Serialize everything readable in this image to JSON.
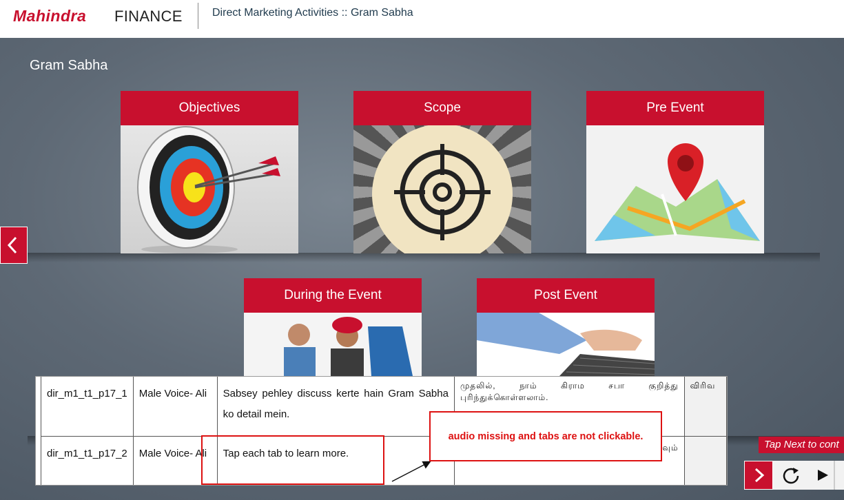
{
  "header": {
    "logo_brand": "Mahindra",
    "logo_suffix": "FINANCE",
    "title": "Direct Marketing Activities :: Gram Sabha"
  },
  "page": {
    "title": "Gram Sabha"
  },
  "tiles": [
    {
      "label": "Objectives",
      "image": "archery-target-icon"
    },
    {
      "label": "Scope",
      "image": "crosshair-icon"
    },
    {
      "label": "Pre Event",
      "image": "map-pin-icon"
    },
    {
      "label": "During the Event",
      "image": "people-photo"
    },
    {
      "label": "Post Event",
      "image": "keyboard-typing-photo"
    }
  ],
  "notes_table": {
    "rows": [
      {
        "id": "dir_m1_t1_p17_1",
        "voice": "Male Voice- Ali",
        "script": "Sabsey pehley discuss kerte hain Gram Sabha ko detail mein.",
        "tamil": "முதலில், நாம் கிராம சபா குறித்து புரிந்துக்கொள்ளலாம்.",
        "extra": "விரிவ"
      },
      {
        "id": "dir_m1_t1_p17_2",
        "voice": "Male Voice- Ali",
        "script": "Tap each tab to learn more.",
        "tamil": "மீதும் தட்டவும்",
        "extra": ""
      }
    ]
  },
  "annotation": {
    "text": "audio missing and tabs are not clickable."
  },
  "player": {
    "tap_next": "Tap Next to cont"
  },
  "colors": {
    "accent": "#c8102e",
    "annotation": "#dd1111"
  }
}
